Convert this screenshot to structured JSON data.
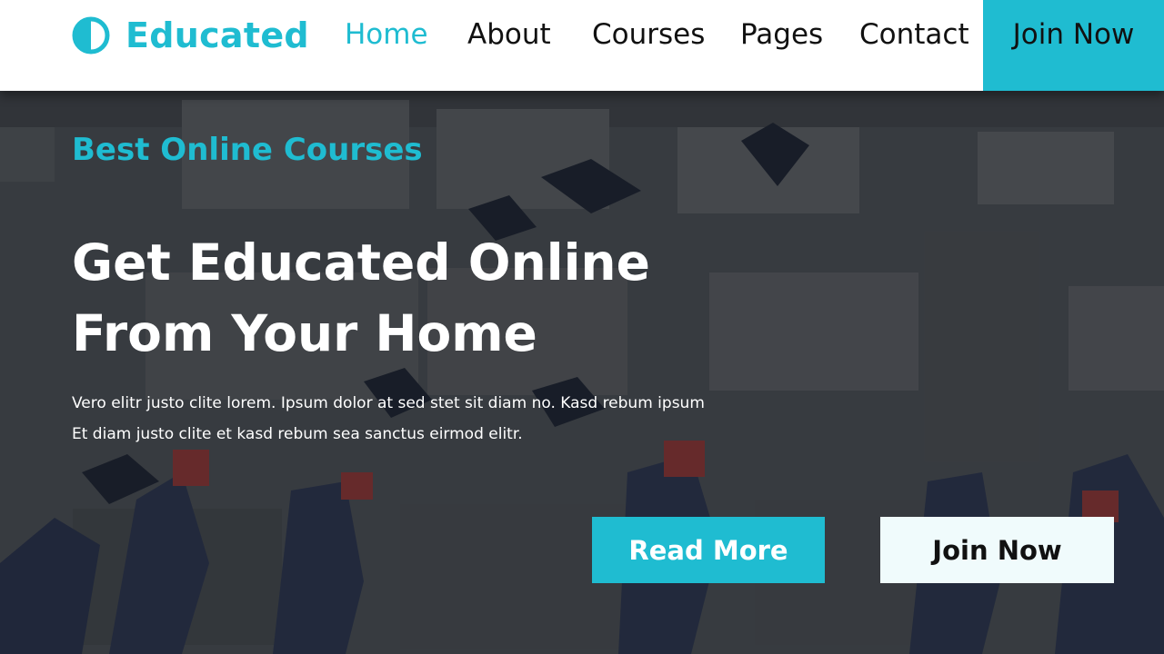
{
  "brand": {
    "name": "Educated",
    "icon": "half-circle-icon",
    "color": "#1fbcd1"
  },
  "nav": {
    "items": [
      {
        "label": "Home",
        "active": true
      },
      {
        "label": "About",
        "active": false
      },
      {
        "label": "Courses",
        "active": false
      },
      {
        "label": "Pages",
        "active": false
      },
      {
        "label": "Contact",
        "active": false
      }
    ],
    "cta_label": "Join Now"
  },
  "hero": {
    "eyebrow": "Best Online Courses",
    "headline_line1": "Get Educated Online",
    "headline_line2": "From Your Home",
    "text_line1": "Vero elitr justo clite lorem. Ipsum dolor at sed stet sit diam no. Kasd rebum ipsum",
    "text_line2": "Et diam justo clite et kasd rebum sea sanctus eirmod elitr.",
    "read_more_label": "Read More",
    "join_now_label": "Join Now"
  },
  "colors": {
    "accent": "#1fbcd1",
    "dark": "#111111",
    "light_button": "#f0fbfc"
  }
}
